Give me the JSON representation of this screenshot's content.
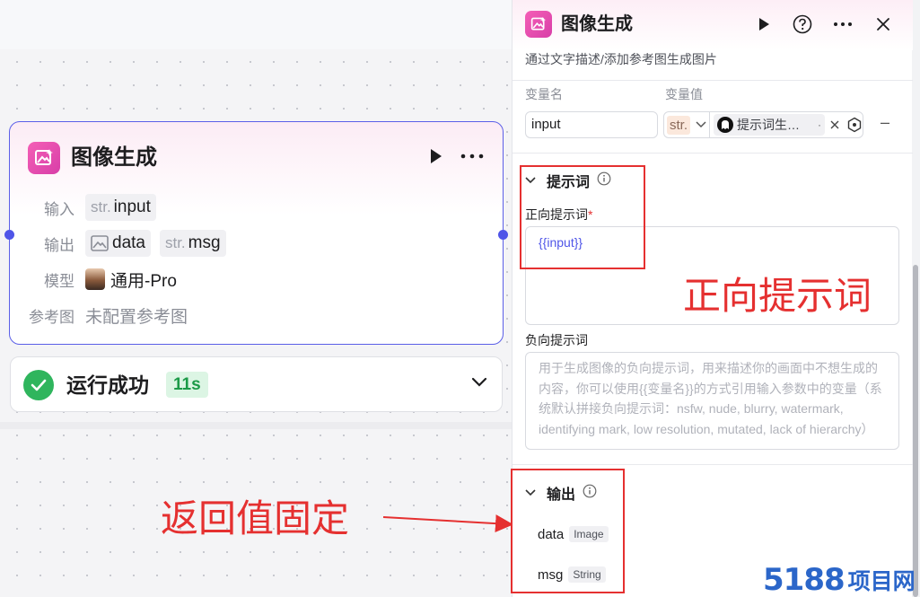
{
  "canvas": {
    "node": {
      "title": "图像生成",
      "rows": {
        "input_label": "输入",
        "input_type": "str.",
        "input_name": "input",
        "output_label": "输出",
        "output_data": "data",
        "output_msg_type": "str.",
        "output_msg": "msg",
        "model_label": "模型",
        "model_value": "通用-Pro",
        "ref_label": "参考图",
        "ref_value": "未配置参考图"
      }
    },
    "run": {
      "status": "运行成功",
      "time": "11s"
    },
    "annotation": "返回值固定"
  },
  "panel": {
    "title": "图像生成",
    "description": "通过文字描述/添加参考图生成图片",
    "columns": {
      "name": "变量名",
      "value": "变量值"
    },
    "variable": {
      "name": "input",
      "type": "str.",
      "ref": "提示词生…",
      "ref_dot": "·"
    },
    "prompt_section": {
      "title": "提示词",
      "positive_label": "正向提示词",
      "required": "*",
      "positive_value": "{{input}}",
      "negative_label": "负向提示词",
      "negative_placeholder": "用于生成图像的负向提示词，用来描述你的画面中不想生成的内容，你可以使用{{变量名}}的方式引用输入参数中的变量（系统默认拼接负向提示词：nsfw, nude, blurry, watermark, identifying mark, low resolution, mutated, lack of hierarchy）",
      "annotation": "正向提示词"
    },
    "output_section": {
      "title": "输出",
      "items": [
        {
          "name": "data",
          "type": "Image"
        },
        {
          "name": "msg",
          "type": "String"
        }
      ]
    }
  },
  "watermark": {
    "number": "5188",
    "text": "项目网"
  },
  "colors": {
    "accent": "#4f55e8",
    "brand_pink": "#e34aae",
    "success": "#2fb55d",
    "annotation_red": "#e53030",
    "watermark_blue": "#2b66c9"
  }
}
